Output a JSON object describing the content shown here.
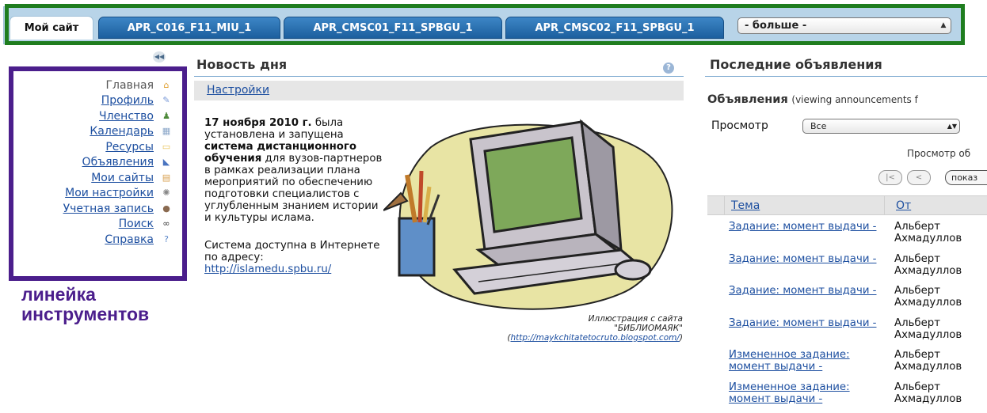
{
  "tabs": [
    {
      "label": "Мой сайт",
      "active": true
    },
    {
      "label": "APR_C016_F11_MIU_1",
      "active": false
    },
    {
      "label": "APR_CMSC01_F11_SPBGU_1",
      "active": false
    },
    {
      "label": "APR_CMSC02_F11_SPBGU_1",
      "active": false
    }
  ],
  "more_select": {
    "value": "- больше -"
  },
  "colors": {
    "tab_frame": "#1f7d1f",
    "menu_frame": "#4b1e8c",
    "link": "#1d4fa0",
    "tab_bg": "#1c5f9e"
  },
  "toolmenu": {
    "items": [
      {
        "label": "Главная",
        "icon": "home-icon",
        "current": true
      },
      {
        "label": "Профиль",
        "icon": "profile-icon"
      },
      {
        "label": "Членство",
        "icon": "membership-icon"
      },
      {
        "label": "Календарь",
        "icon": "calendar-icon"
      },
      {
        "label": "Ресурсы",
        "icon": "folder-icon"
      },
      {
        "label": "Объявления",
        "icon": "megaphone-icon"
      },
      {
        "label": "Мои сайты",
        "icon": "sites-icon"
      },
      {
        "label": "Мои настройки",
        "icon": "gear-icon"
      },
      {
        "label": "Учетная запись",
        "icon": "user-icon"
      },
      {
        "label": "Поиск",
        "icon": "binoculars-icon"
      },
      {
        "label": "Справка",
        "icon": "help-icon"
      }
    ],
    "caption_line1": "линейка",
    "caption_line2": "инструментов"
  },
  "news": {
    "title": "Новость дня",
    "settings_link": "Настройки",
    "date": "17 ноября 2010 г.",
    "text_1": " была установлена и запущена ",
    "bold_system": "система дистанционного обучения",
    "text_2": " для вузов-партнеров в рамках реализации плана мероприятий по обеспечению подготовки специалистов с углубленным знанием истории и культуры ислама.",
    "text_3": "Система доступна в Интернете по адресу:",
    "url": "http://islamedu.spbu.ru/",
    "credit_line1": "Иллюстрация с сайта",
    "credit_line2": "\"БИБЛИОМАЯК\"",
    "credit_url": "http://maykchitatetocruto.blogspot.com/"
  },
  "announcements": {
    "title": "Последние объявления",
    "subtitle_bold": "Объявления",
    "subtitle_rest": "(viewing announcements f",
    "view_label": "Просмотр",
    "view_value": "Все",
    "view_count": "Просмотр об",
    "first_btn": "|<",
    "prev_btn": "<",
    "show_btn": "показ",
    "col_subject": "Тема",
    "col_from": "От",
    "rows": [
      {
        "subject": "Задание: момент выдачи -",
        "from": "Альберт Ахмадуллов"
      },
      {
        "subject": "Задание: момент выдачи -",
        "from": "Альберт Ахмадуллов"
      },
      {
        "subject": "Задание: момент выдачи -",
        "from": "Альберт Ахмадуллов"
      },
      {
        "subject": "Задание: момент выдачи -",
        "from": "Альберт Ахмадуллов"
      },
      {
        "subject": "Измененное задание: момент выдачи -",
        "from": "Альберт Ахмадуллов"
      },
      {
        "subject": "Измененное задание: момент выдачи -",
        "from": "Альберт Ахмадуллов"
      }
    ]
  }
}
